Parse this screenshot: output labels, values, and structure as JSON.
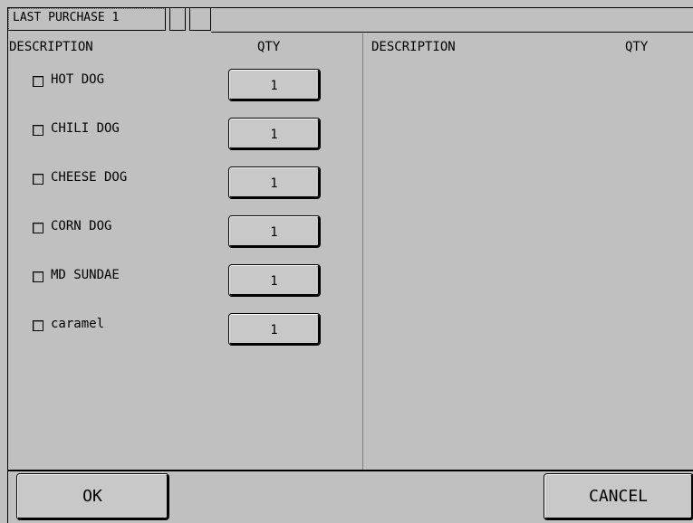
{
  "tabs": [
    {
      "label": "LAST PURCHASE 1"
    },
    {
      "label": ""
    },
    {
      "label": ""
    }
  ],
  "left_panel": {
    "description_header": "DESCRIPTION",
    "qty_header": "QTY",
    "items": [
      {
        "description": "HOT DOG",
        "qty": "1",
        "checked": false
      },
      {
        "description": "CHILI DOG",
        "qty": "1",
        "checked": false
      },
      {
        "description": "CHEESE DOG",
        "qty": "1",
        "checked": false
      },
      {
        "description": "CORN DOG",
        "qty": "1",
        "checked": false
      },
      {
        "description": "MD SUNDAE",
        "qty": "1",
        "checked": false
      },
      {
        "description": "caramel",
        "qty": "1",
        "checked": false
      }
    ]
  },
  "right_panel": {
    "description_header": "DESCRIPTION",
    "qty_header": "QTY",
    "items": []
  },
  "footer": {
    "ok_label": "OK",
    "cancel_label": "CANCEL"
  },
  "colors": {
    "background": "#c0c0c0",
    "button_face": "#c8c8c8",
    "border": "#000000"
  }
}
